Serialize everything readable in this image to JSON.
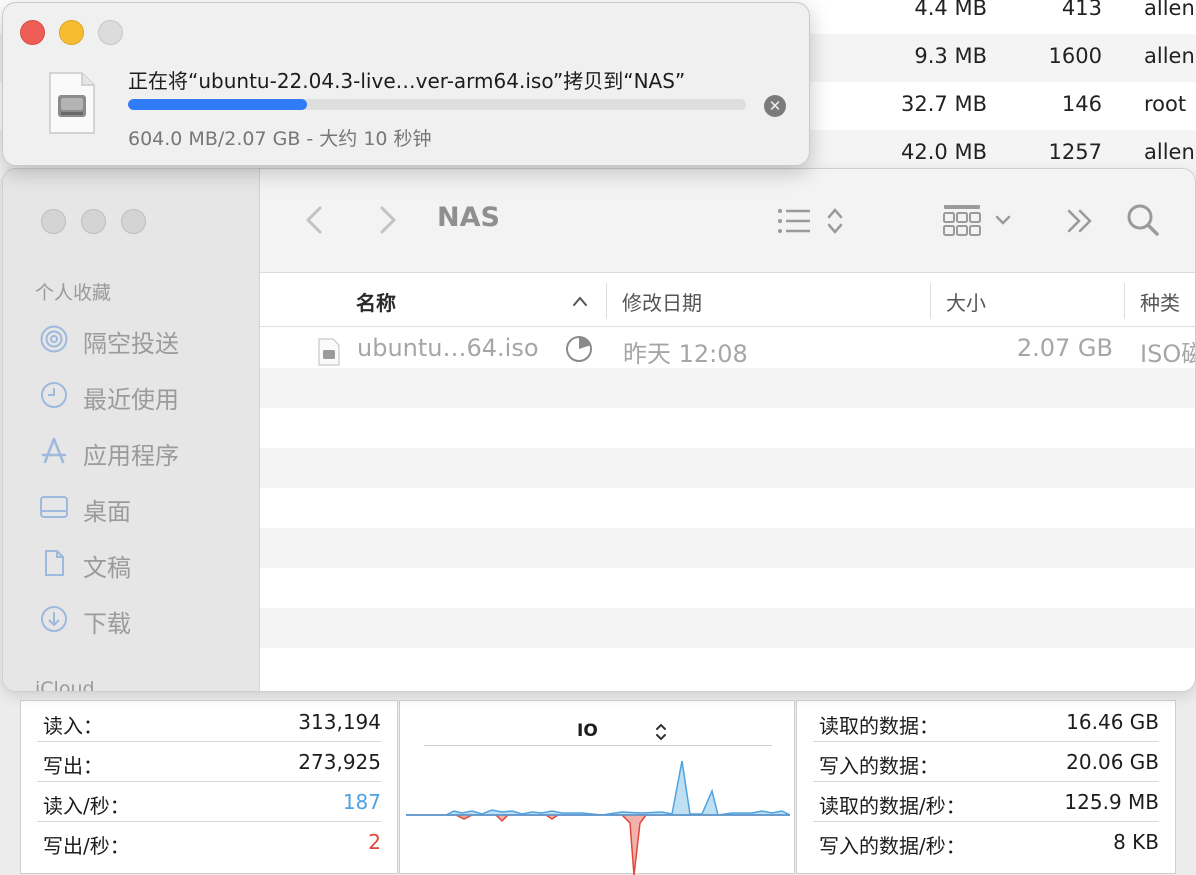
{
  "background_table": {
    "rows": [
      {
        "size": "4.4 MB",
        "threads": "413",
        "user": "allen"
      },
      {
        "size": "9.3 MB",
        "threads": "1600",
        "user": "allen"
      },
      {
        "size": "32.7 MB",
        "threads": "146",
        "user": "root"
      },
      {
        "size": "42.0 MB",
        "threads": "1257",
        "user": "allen"
      }
    ]
  },
  "copy_dialog": {
    "title": "正在将“ubuntu-22.04.3-live…ver-arm64.iso”拷贝到“NAS”",
    "status": "604.0 MB/2.07 GB - 大约 10 秒钟",
    "progress_fraction": 0.29,
    "accent_color": "#2f7cf6",
    "cancel_icon": "x-circle-icon"
  },
  "finder": {
    "window_title": "NAS",
    "sidebar": {
      "heading": "个人收藏",
      "items": [
        {
          "label": "隔空投送",
          "icon": "airdrop-icon"
        },
        {
          "label": "最近使用",
          "icon": "clock-icon"
        },
        {
          "label": "应用程序",
          "icon": "applications-icon"
        },
        {
          "label": "桌面",
          "icon": "desktop-icon"
        },
        {
          "label": "文稿",
          "icon": "document-icon"
        },
        {
          "label": "下载",
          "icon": "download-icon"
        }
      ],
      "icloud_heading": "iCloud"
    },
    "columns": {
      "name": "名称",
      "date": "修改日期",
      "size": "大小",
      "kind": "种类"
    },
    "files": [
      {
        "name": "ubuntu…64.iso",
        "date": "昨天 12:08",
        "size": "2.07 GB",
        "kind": "ISO磁"
      }
    ]
  },
  "activity_monitor": {
    "left": [
      {
        "label": "读入：",
        "value": "313,194"
      },
      {
        "label": "写出：",
        "value": "273,925"
      },
      {
        "label": "读入/秒：",
        "value": "187"
      },
      {
        "label": "写出/秒：",
        "value": "2"
      }
    ],
    "chart_title": "IO",
    "right": [
      {
        "label": "读取的数据：",
        "value": "16.46 GB"
      },
      {
        "label": "写入的数据：",
        "value": "20.06 GB"
      },
      {
        "label": "读取的数据/秒：",
        "value": "125.9 MB"
      },
      {
        "label": "写入的数据/秒：",
        "value": "8 KB"
      }
    ],
    "colors": {
      "read": "#4fa3e0",
      "write": "#e2463c"
    }
  }
}
